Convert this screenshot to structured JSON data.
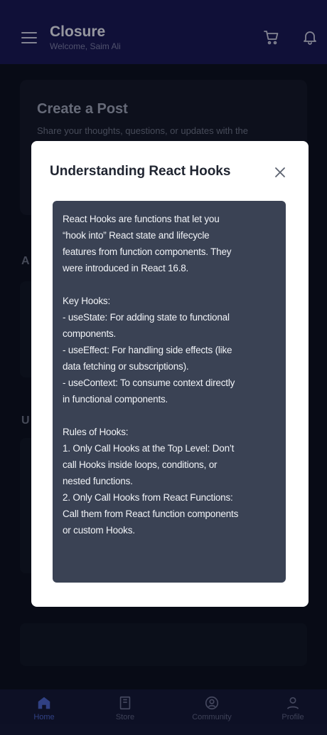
{
  "header": {
    "title": "Closure",
    "subtitle": "Welcome, Saim Ali",
    "menu_icon": "hamburger-menu-icon",
    "cart_icon": "cart-icon",
    "notification_icon": "bell-icon"
  },
  "background": {
    "create_post_title": "Create a Post",
    "create_post_subtitle": "Share your thoughts, questions, or updates with the",
    "section_letter_1": "A",
    "section_letter_2": "U"
  },
  "modal": {
    "title": "Understanding React Hooks",
    "close_icon": "close-icon",
    "content": "React Hooks are functions that let you\n“hook into” React state and lifecycle\nfeatures from function components. They\nwere introduced in React 16.8.\n\nKey Hooks:\n- useState: For adding state to functional\ncomponents.\n- useEffect: For handling side effects (like\ndata fetching or subscriptions).\n- useContext: To consume context directly\nin functional components.\n\nRules of Hooks:\n1. Only Call Hooks at the Top Level: Don’t\ncall Hooks inside loops, conditions, or\nnested functions.\n2. Only Call Hooks from React Functions:\nCall them from React function components\nor custom Hooks."
  },
  "bottom_nav": {
    "items": [
      {
        "label": "Home",
        "icon": "home-icon",
        "active": true
      },
      {
        "label": "Store",
        "icon": "store-icon",
        "active": false
      },
      {
        "label": "Community",
        "icon": "community-icon",
        "active": false
      },
      {
        "label": "Profile",
        "icon": "profile-icon",
        "active": false
      }
    ]
  },
  "colors": {
    "header_bg": "#1a1957",
    "nav_active": "#4b63c9",
    "modal_body_bg": "#3a4254"
  }
}
